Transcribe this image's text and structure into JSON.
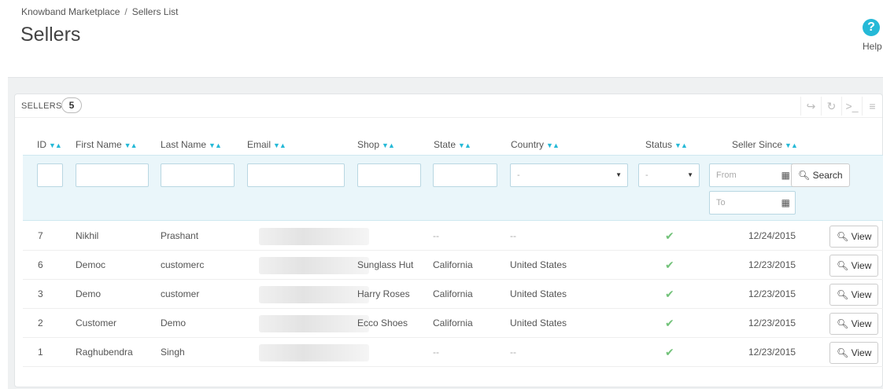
{
  "header": {
    "breadcrumb": [
      "Knowband Marketplace",
      "Sellers List"
    ],
    "title": "Sellers",
    "help_label": "Help"
  },
  "panel": {
    "title": "SELLERS",
    "count": "5"
  },
  "columns": [
    "ID",
    "First Name",
    "Last Name",
    "Email",
    "Shop",
    "State",
    "Country",
    "Status",
    "Seller Since"
  ],
  "filters": {
    "country_selected": "-",
    "status_selected": "-",
    "from_placeholder": "From",
    "to_placeholder": "To",
    "search_label": "Search"
  },
  "rows": [
    {
      "id": "7",
      "first": "Nikhil",
      "last": "Prashant",
      "shop": "",
      "state": "--",
      "country": "--",
      "since": "12/24/2015"
    },
    {
      "id": "6",
      "first": "Democ",
      "last": "customerc",
      "shop": "Sunglass Hut",
      "state": "California",
      "country": "United States",
      "since": "12/23/2015"
    },
    {
      "id": "3",
      "first": "Demo",
      "last": "customer",
      "shop": "Harry Roses",
      "state": "California",
      "country": "United States",
      "since": "12/23/2015"
    },
    {
      "id": "2",
      "first": "Customer",
      "last": "Demo",
      "shop": "Ecco Shoes",
      "state": "California",
      "country": "United States",
      "since": "12/23/2015"
    },
    {
      "id": "1",
      "first": "Raghubendra",
      "last": "Singh",
      "shop": "",
      "state": "--",
      "country": "--",
      "since": "12/23/2015"
    }
  ],
  "view_label": "View",
  "icons": {
    "help": "question-circle-icon",
    "sort": "sort-arrows-icon",
    "calendar": "calendar-icon",
    "search": "magnifier-icon",
    "status_active": "check-icon",
    "view": "zoom-in-icon"
  },
  "colors": {
    "accent": "#25b9d7",
    "status_active": "#72c279",
    "filter_background": "#eaf6fa"
  }
}
